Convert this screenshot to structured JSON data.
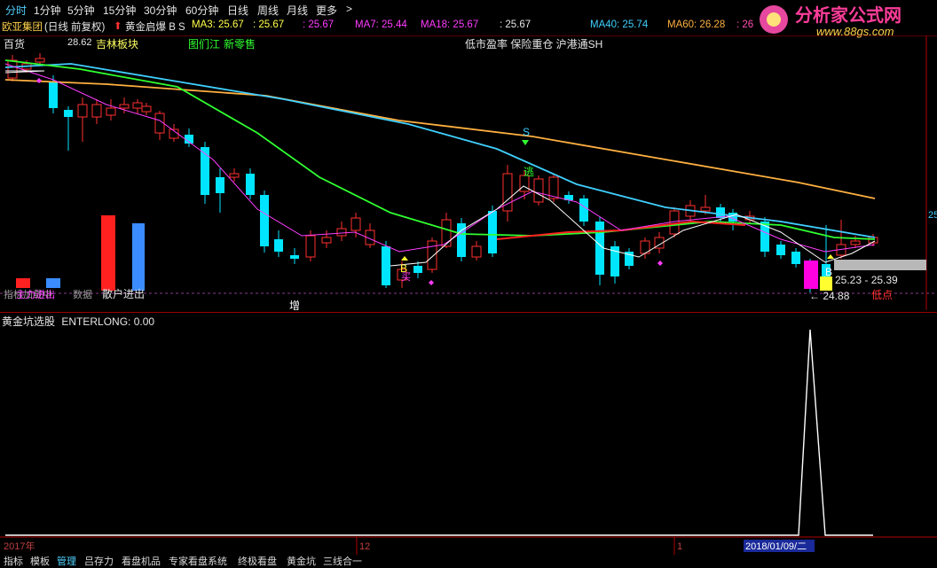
{
  "topbar": {
    "items": [
      "分时",
      "1分钟",
      "5分钟",
      "15分钟",
      "30分钟",
      "60分钟",
      "日线",
      "周线",
      "月线",
      "更多",
      ">"
    ],
    "active": "分时",
    "right_icons": [
      "副",
      "本",
      "加"
    ]
  },
  "logo": {
    "title": "分析家公式网",
    "url": "www.88gs.com"
  },
  "ma_bar": {
    "stock": "欧亚集团",
    "period": "(日线 前复权)",
    "indicator": "黄金启爆 B S",
    "ma3": "MA3: 25.67",
    "v1": ": 25.67",
    "v2": ": 25.67",
    "ma7": "MA7: 25.44",
    "ma18": "MA18: 25.67",
    "v3": ": 25.67",
    "ma40": "MA40: 25.74",
    "ma60": "MA60: 26.28",
    "v4": ": 26"
  },
  "main_labels": {
    "sector1": "百货",
    "price_high": "28.62",
    "sector2": "吉林板块",
    "sector3": "图们江",
    "sector4": "新零售",
    "tags": "低市盈率 保险重仓 沪港通SH",
    "s_mark": "S",
    "escape": "逃",
    "b_mark1": "B",
    "b_mark1_sub": "买",
    "b_mark2": "B",
    "range": "25.23 - 25.39",
    "price_low": "24.88",
    "low_label": "低点",
    "left_axis": "25",
    "bottom_tag1": "散户进出",
    "bottom_tag2": "主力进出",
    "bottom_tag3": "指标加载中",
    "bottom_tag4": "数据",
    "zeng": "增"
  },
  "sub_panel": {
    "title": "黄金坑选股",
    "value": "ENTERLONG: 0.00"
  },
  "timeline": {
    "labels": [
      "2017年",
      "12",
      "1"
    ],
    "date_box": "2018/01/09/二"
  },
  "bottombar": {
    "items": [
      "指标",
      "模板",
      "管理",
      "吕存力",
      "看盘机品",
      "专家看盘系统",
      "终极看盘",
      "黄金坑",
      "三线合一"
    ]
  },
  "colors": {
    "up": "#ff3030",
    "down": "#00e5ff",
    "ma3": "#ffffff",
    "ma7": "#ff3cff",
    "ma18": "#30ff30",
    "ma40": "#40d0ff",
    "ma60": "#ffb040",
    "grid": "#b00000"
  }
}
